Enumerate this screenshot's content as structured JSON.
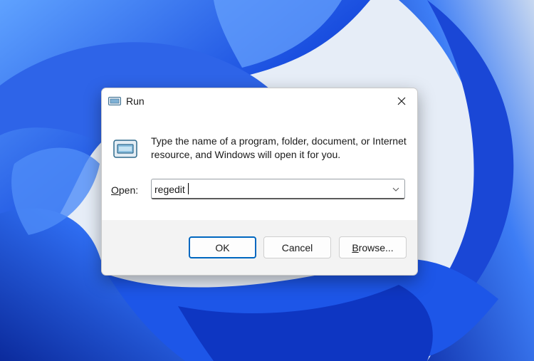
{
  "dialog": {
    "title": "Run",
    "description": "Type the name of a program, folder, document, or Internet resource, and Windows will open it for you.",
    "open_label_underlined": "O",
    "open_label_rest": "pen:",
    "input_value": "regedit",
    "buttons": {
      "ok": "OK",
      "cancel": "Cancel",
      "browse_underlined": "B",
      "browse_rest": "rowse..."
    }
  },
  "colors": {
    "accent": "#0067c0",
    "wallpaper_primary": "#1f4fd8",
    "dialog_background": "#f3f3f3"
  },
  "icons": {
    "title": "run-app-icon",
    "close": "close-icon",
    "body": "run-app-icon",
    "dropdown": "chevron-down-icon"
  }
}
